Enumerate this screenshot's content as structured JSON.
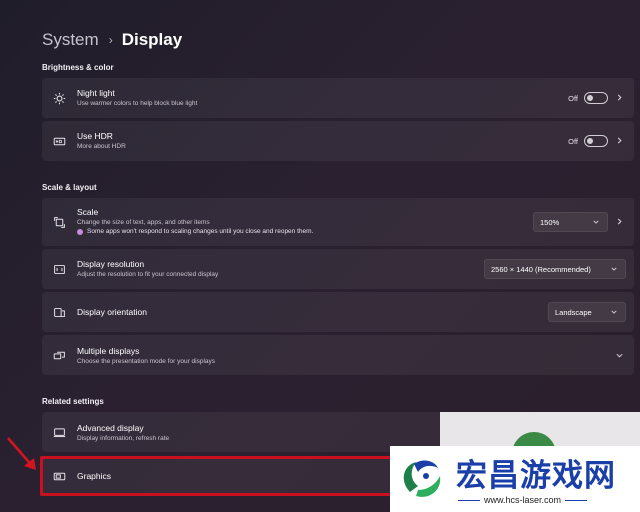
{
  "breadcrumb": {
    "parent": "System",
    "separator": "›",
    "current": "Display"
  },
  "sections": {
    "brightness": "Brightness & color",
    "scale": "Scale & layout",
    "related": "Related settings"
  },
  "night_light": {
    "title": "Night light",
    "sub": "Use warmer colors to help block blue light",
    "state": "Off",
    "icon": "brightness-icon"
  },
  "hdr": {
    "title": "Use HDR",
    "sub": "More about HDR",
    "state": "Off",
    "icon": "hdr-icon"
  },
  "scale": {
    "title": "Scale",
    "sub": "Change the size of text, apps, and other items",
    "warning": "Some apps won't respond to scaling changes until you close and reopen them.",
    "value": "150%",
    "icon": "scale-icon"
  },
  "resolution": {
    "title": "Display resolution",
    "sub": "Adjust the resolution to fit your connected display",
    "value": "2560 × 1440 (Recommended)",
    "icon": "resolution-icon"
  },
  "orientation": {
    "title": "Display orientation",
    "value": "Landscape",
    "icon": "orientation-icon"
  },
  "multiple": {
    "title": "Multiple displays",
    "sub": "Choose the presentation mode for your displays",
    "icon": "multiple-displays-icon"
  },
  "advanced": {
    "title": "Advanced display",
    "sub": "Display information, refresh rate",
    "icon": "monitor-icon"
  },
  "graphics": {
    "title": "Graphics",
    "icon": "graphics-icon"
  },
  "watermark": {
    "title": "宏昌游戏网",
    "url": "www.hcs-laser.com"
  },
  "colors": {
    "highlight": "#c8101e",
    "watermark_blue": "#1a3fa8",
    "warning_dot": "#c48cdc"
  }
}
